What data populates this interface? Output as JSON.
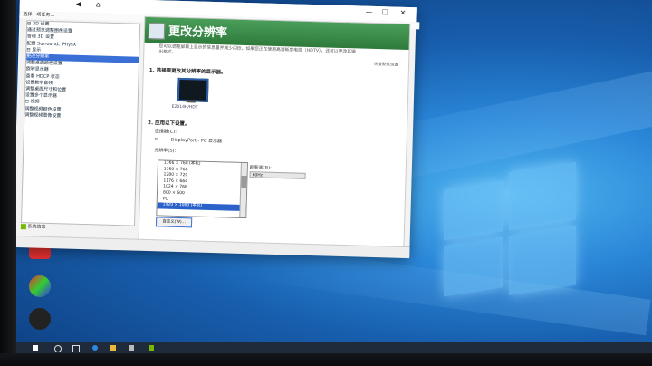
{
  "window": {
    "title": "选择一项任务...",
    "controls": {
      "minimize": "—",
      "maximize": "☐",
      "close": "✕"
    }
  },
  "tree": {
    "items": [
      {
        "label": "⊟ 3D 设置"
      },
      {
        "label": "    通过预览调整图像设置"
      },
      {
        "label": "    管理 3D 设置"
      },
      {
        "label": "    配置 Surround、PhysX"
      },
      {
        "label": "⊟ 显示"
      },
      {
        "label": "    更改分辨率",
        "selected": true
      },
      {
        "label": "    调整桌面颜色设置"
      },
      {
        "label": "    旋转显示器"
      },
      {
        "label": "    查看 HDCP 状态"
      },
      {
        "label": "    设置数字音频"
      },
      {
        "label": "    调整桌面尺寸和位置"
      },
      {
        "label": "    设置多个显示器"
      },
      {
        "label": "⊟ 视频"
      },
      {
        "label": "    调整视频颜色设置"
      },
      {
        "label": "    调整视频图像设置"
      }
    ]
  },
  "help": {
    "label": "系统信息"
  },
  "content": {
    "title": "更改分辨率",
    "description": "您可以调整屏幕上显示的信息量并减少闪烁，如果您正在使用高清晰度电视（HDTV），还可以更改其输出格式。",
    "restore_defaults": "恢复默认设置",
    "step1": "1. 选择要更改其分辨率的显示器。",
    "monitor_label": "E2014H/HDT",
    "step2": "2. 应用以下设置。",
    "connector_label": "连接器(C):",
    "connector_value": "DisplayPort - PC 显示器",
    "resolution_label": "分辨率(S):",
    "refresh_label": "刷新率(R):",
    "refresh_value": "60Hz",
    "resolutions": [
      {
        "label": "1366 × 768  (本机)"
      },
      {
        "label": "1360 × 768"
      },
      {
        "label": "1280 × 720"
      },
      {
        "label": "1176 × 664"
      },
      {
        "label": "1024 × 768"
      },
      {
        "label": "800 × 600"
      },
      {
        "label": "PC"
      },
      {
        "label": "1920 × 1080 (本机)",
        "selected": true
      }
    ],
    "customize_button": "自定义(W)..."
  },
  "osd": {
    "value": "14"
  },
  "colors": {
    "accent": "#3a6fd6",
    "header": "#2f7a3b",
    "desktop": "#1a6fc4"
  }
}
